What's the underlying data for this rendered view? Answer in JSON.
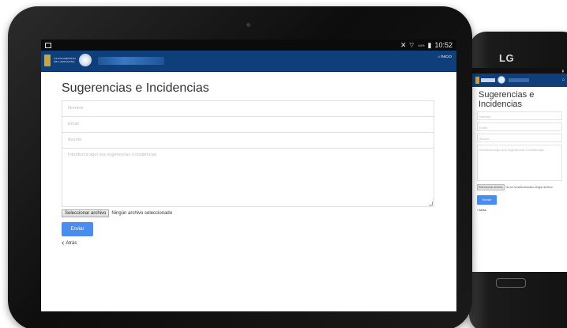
{
  "tablet": {
    "status": {
      "time": "10:52",
      "battery": "64%"
    },
    "header": {
      "town_name_1": "AYUNTAMIENTO",
      "town_name_2": "DE CARTAGENA",
      "home_label": "INICIO"
    },
    "page_title": "Sugerencias e Incidencias",
    "form": {
      "name_placeholder": "Nombre",
      "email_placeholder": "Email",
      "subject_placeholder": "Asunto",
      "message_placeholder": "Introduzca aquí sus sugerencias o incidencias",
      "file_button": "Seleccionar archivo",
      "file_status": "Ningún archivo seleccionado",
      "send_button": "Enviar",
      "back_link": "Atrás"
    }
  },
  "phone": {
    "brand": "LG",
    "page_title": "Sugerencias e Incidencias",
    "form": {
      "name_placeholder": "Nombre",
      "email_placeholder": "Email",
      "subject_placeholder": "Asunto",
      "message_placeholder": "Introduzca aquí sus sugerencias o incidencias",
      "file_button": "Seleccionar archivo",
      "file_status": "No se ha seleccionado ningún archivo",
      "send_button": "Enviar",
      "back_link": "Atrás"
    }
  },
  "colors": {
    "header": "#0f3f7a",
    "accent": "#4a8df0",
    "emblem": "#c7a447"
  },
  "icons": [
    "home-icon",
    "chevron-left-icon",
    "wifi-icon",
    "battery-icon",
    "notification-icon"
  ]
}
